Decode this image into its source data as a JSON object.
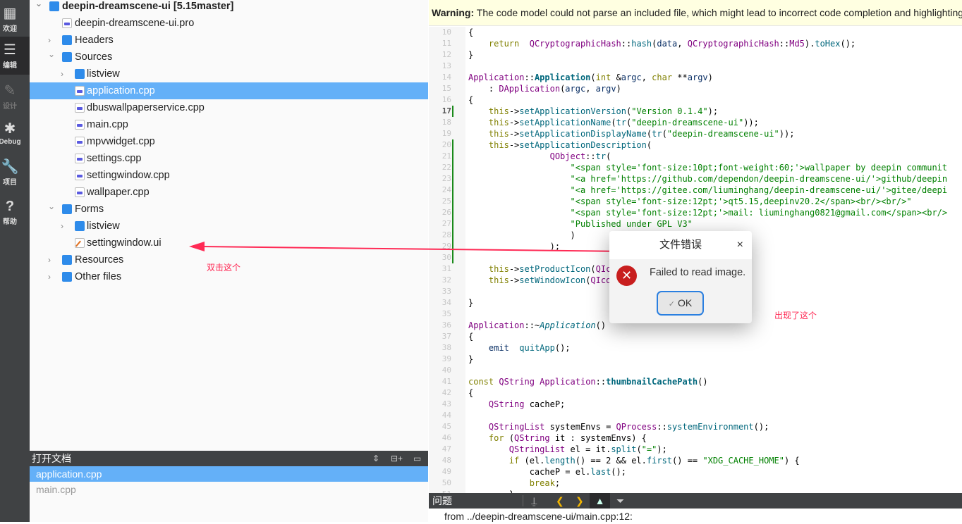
{
  "activity": [
    {
      "label": "欢迎",
      "icon": "grid-icon",
      "glyph": "▦"
    },
    {
      "label": "编辑",
      "icon": "edit-icon",
      "glyph": "☰",
      "active": true
    },
    {
      "label": "设计",
      "icon": "pencil-icon",
      "glyph": "✎",
      "dim": true
    },
    {
      "label": "Debug",
      "icon": "bug-icon",
      "glyph": "✱"
    },
    {
      "label": "项目",
      "icon": "wrench-icon",
      "glyph": "🔧"
    },
    {
      "label": "帮助",
      "icon": "help-icon",
      "glyph": "?"
    }
  ],
  "tree": [
    {
      "label": "deepin-dreamscene-ui [5.15master]",
      "level": 0,
      "arrow": "down",
      "icon": "project-folder",
      "bold": true
    },
    {
      "label": "deepin-dreamscene-ui.pro",
      "level": 1,
      "arrow": "",
      "icon": "pro-file"
    },
    {
      "label": "Headers",
      "level": 1,
      "arrow": "right",
      "icon": "headers-folder"
    },
    {
      "label": "Sources",
      "level": 1,
      "arrow": "down",
      "icon": "sources-folder"
    },
    {
      "label": "listview",
      "level": 2,
      "arrow": "right",
      "icon": "folder"
    },
    {
      "label": "application.cpp",
      "level": 2,
      "arrow": "",
      "icon": "cpp-file",
      "selected": true
    },
    {
      "label": "dbuswallpaperservice.cpp",
      "level": 2,
      "arrow": "",
      "icon": "cpp-file"
    },
    {
      "label": "main.cpp",
      "level": 2,
      "arrow": "",
      "icon": "cpp-file"
    },
    {
      "label": "mpvwidget.cpp",
      "level": 2,
      "arrow": "",
      "icon": "cpp-file"
    },
    {
      "label": "settings.cpp",
      "level": 2,
      "arrow": "",
      "icon": "cpp-file"
    },
    {
      "label": "settingwindow.cpp",
      "level": 2,
      "arrow": "",
      "icon": "cpp-file"
    },
    {
      "label": "wallpaper.cpp",
      "level": 2,
      "arrow": "",
      "icon": "cpp-file"
    },
    {
      "label": "Forms",
      "level": 1,
      "arrow": "down",
      "icon": "forms-folder"
    },
    {
      "label": "listview",
      "level": 2,
      "arrow": "right",
      "icon": "folder"
    },
    {
      "label": "settingwindow.ui",
      "level": 2,
      "arrow": "",
      "icon": "ui-file"
    },
    {
      "label": "Resources",
      "level": 1,
      "arrow": "right",
      "icon": "resources-folder"
    },
    {
      "label": "Other files",
      "level": 1,
      "arrow": "right",
      "icon": "other-folder"
    }
  ],
  "open_docs": {
    "title": "打开文档",
    "items": [
      {
        "label": "application.cpp",
        "selected": true
      },
      {
        "label": "main.cpp"
      }
    ]
  },
  "warning": {
    "bold": "Warning:",
    "text": " The code model could not parse an included file, which might lead to incorrect code completion and highlighting"
  },
  "editor": {
    "first_line": 10,
    "current_line": 17,
    "changed": [
      [
        17,
        17
      ],
      [
        20,
        30
      ]
    ],
    "lines": [
      [
        [
          "",
          "{"
        ]
      ],
      [
        [
          "",
          "    "
        ],
        [
          "k",
          "return"
        ],
        [
          "",
          "  "
        ],
        [
          "t",
          "QCryptographicHash"
        ],
        [
          "",
          "::"
        ],
        [
          "f",
          "hash"
        ],
        [
          "",
          "("
        ],
        [
          "v",
          "data"
        ],
        [
          "",
          ", "
        ],
        [
          "t",
          "QCryptographicHash"
        ],
        [
          "",
          "::"
        ],
        [
          "t",
          "Md5"
        ],
        [
          "",
          ")."
        ],
        [
          "f",
          "toHex"
        ],
        [
          "",
          "();"
        ]
      ],
      [
        [
          "",
          "}"
        ]
      ],
      [],
      [
        [
          "t",
          "Application"
        ],
        [
          "",
          "::"
        ],
        [
          "b",
          "Application"
        ],
        [
          "",
          "("
        ],
        [
          "k",
          "int"
        ],
        [
          "",
          " &"
        ],
        [
          "v",
          "argc"
        ],
        [
          "",
          ", "
        ],
        [
          "k",
          "char"
        ],
        [
          "",
          " **"
        ],
        [
          "v",
          "argv"
        ],
        [
          "",
          ")"
        ]
      ],
      [
        [
          "",
          "    : "
        ],
        [
          "t",
          "DApplication"
        ],
        [
          "",
          "("
        ],
        [
          "v",
          "argc"
        ],
        [
          "",
          ", "
        ],
        [
          "v",
          "argv"
        ],
        [
          "",
          ")"
        ]
      ],
      [
        [
          "",
          "{"
        ]
      ],
      [
        [
          "",
          "    "
        ],
        [
          "k",
          "this"
        ],
        [
          "",
          "->"
        ],
        [
          "f",
          "setApplicationVersion"
        ],
        [
          "",
          "("
        ],
        [
          "s",
          "\"Version 0.1.4\""
        ],
        [
          "",
          ");"
        ]
      ],
      [
        [
          "",
          "    "
        ],
        [
          "k",
          "this"
        ],
        [
          "",
          "->"
        ],
        [
          "f",
          "setApplicationName"
        ],
        [
          "",
          "("
        ],
        [
          "f",
          "tr"
        ],
        [
          "",
          "("
        ],
        [
          "s",
          "\"deepin-dreamscene-ui\""
        ],
        [
          "",
          "));"
        ]
      ],
      [
        [
          "",
          "    "
        ],
        [
          "k",
          "this"
        ],
        [
          "",
          "->"
        ],
        [
          "f",
          "setApplicationDisplayName"
        ],
        [
          "",
          "("
        ],
        [
          "f",
          "tr"
        ],
        [
          "",
          "("
        ],
        [
          "s",
          "\"deepin-dreamscene-ui\""
        ],
        [
          "",
          "));"
        ]
      ],
      [
        [
          "",
          "    "
        ],
        [
          "k",
          "this"
        ],
        [
          "",
          "->"
        ],
        [
          "f",
          "setApplicationDescription"
        ],
        [
          "",
          "("
        ]
      ],
      [
        [
          "",
          "                "
        ],
        [
          "t",
          "QObject"
        ],
        [
          "",
          "::"
        ],
        [
          "f",
          "tr"
        ],
        [
          "",
          "("
        ]
      ],
      [
        [
          "",
          "                    "
        ],
        [
          "s",
          "\"<span style='font-size:10pt;font-weight:60;'>wallpaper by deepin communit"
        ]
      ],
      [
        [
          "",
          "                    "
        ],
        [
          "s",
          "\"<a href='https://github.com/dependon/deepin-dreamscene-ui/'>github/deepin"
        ]
      ],
      [
        [
          "",
          "                    "
        ],
        [
          "s",
          "\"<a href='https://gitee.com/liuminghang/deepin-dreamscene-ui/'>gitee/deepi"
        ]
      ],
      [
        [
          "",
          "                    "
        ],
        [
          "s",
          "\"<span style='font-size:12pt;'>qt5.15,deepinv20.2</span><br/><br/>\""
        ]
      ],
      [
        [
          "",
          "                    "
        ],
        [
          "s",
          "\"<span style='font-size:12pt;'>mail: liuminghang0821@gmail.com</span><br/>"
        ]
      ],
      [
        [
          "",
          "                    "
        ],
        [
          "s",
          "\"Published under GPL V3\""
        ]
      ],
      [
        [
          "",
          "                    )"
        ]
      ],
      [
        [
          "",
          "                );"
        ]
      ],
      [],
      [
        [
          "",
          "    "
        ],
        [
          "k",
          "this"
        ],
        [
          "",
          "->"
        ],
        [
          "f",
          "setProductIcon"
        ],
        [
          "",
          "("
        ],
        [
          "t",
          "QIc"
        ]
      ],
      [
        [
          "",
          "    "
        ],
        [
          "k",
          "this"
        ],
        [
          "",
          "->"
        ],
        [
          "f",
          "setWindowIcon"
        ],
        [
          "",
          "("
        ],
        [
          "t",
          "QIco"
        ]
      ],
      [],
      [
        [
          "",
          "}"
        ]
      ],
      [],
      [
        [
          "t",
          "Application"
        ],
        [
          "",
          "::~"
        ],
        [
          "i",
          "Application"
        ],
        [
          "",
          "()"
        ]
      ],
      [
        [
          "",
          "{"
        ]
      ],
      [
        [
          "",
          "    "
        ],
        [
          "v",
          "emit"
        ],
        [
          "",
          "",
          " "
        ],
        [
          "f",
          " quitApp"
        ],
        [
          "",
          "();"
        ]
      ],
      [
        [
          "",
          "}"
        ]
      ],
      [],
      [
        [
          "k",
          "const"
        ],
        [
          "",
          " "
        ],
        [
          "t",
          "QString"
        ],
        [
          "",
          " "
        ],
        [
          "t",
          "Application"
        ],
        [
          "",
          "::"
        ],
        [
          "b",
          "thumbnailCachePath"
        ],
        [
          "",
          "()"
        ]
      ],
      [
        [
          "",
          "{"
        ]
      ],
      [
        [
          "",
          "    "
        ],
        [
          "t",
          "QString"
        ],
        [
          "",
          " cacheP;"
        ]
      ],
      [],
      [
        [
          "",
          "    "
        ],
        [
          "t",
          "QStringList"
        ],
        [
          "",
          " systemEnvs = "
        ],
        [
          "t",
          "QProcess"
        ],
        [
          "",
          "::"
        ],
        [
          "f",
          "systemEnvironment"
        ],
        [
          "",
          "();"
        ]
      ],
      [
        [
          "",
          "    "
        ],
        [
          "k",
          "for"
        ],
        [
          "",
          " ("
        ],
        [
          "t",
          "QString"
        ],
        [
          "",
          " it : systemEnvs) {"
        ]
      ],
      [
        [
          "",
          "        "
        ],
        [
          "t",
          "QStringList"
        ],
        [
          "",
          " el = it."
        ],
        [
          "f",
          "split"
        ],
        [
          "",
          "("
        ],
        [
          "s",
          "\"=\""
        ],
        [
          "",
          ");"
        ]
      ],
      [
        [
          "",
          "        "
        ],
        [
          "k",
          "if"
        ],
        [
          "",
          " (el."
        ],
        [
          "f",
          "length"
        ],
        [
          "",
          "() == 2 && el."
        ],
        [
          "f",
          "first"
        ],
        [
          "",
          "() == "
        ],
        [
          "s",
          "\"XDG_CACHE_HOME\""
        ],
        [
          "",
          ") {"
        ]
      ],
      [
        [
          "",
          "            cacheP = el."
        ],
        [
          "f",
          "last"
        ],
        [
          "",
          "();"
        ]
      ],
      [
        [
          "",
          "            "
        ],
        [
          "k",
          "break"
        ],
        [
          "",
          ";"
        ]
      ],
      [
        [
          "",
          "        }"
        ]
      ]
    ]
  },
  "problems": {
    "title": "问题"
  },
  "output": {
    "text": "from ../deepin-dreamscene-ui/main.cpp:12:"
  },
  "dialog": {
    "title": "文件错误",
    "message": "Failed to read image.",
    "ok": "OK",
    "close": "×",
    "check": "✓",
    "error": "✕"
  },
  "annotations": {
    "left": "双击这个",
    "right": "出现了这个",
    "color": "#ff2a55"
  },
  "colors": {
    "selection": "#64b0f8",
    "dark": "#404244",
    "warning_bg": "#ffffe1"
  }
}
